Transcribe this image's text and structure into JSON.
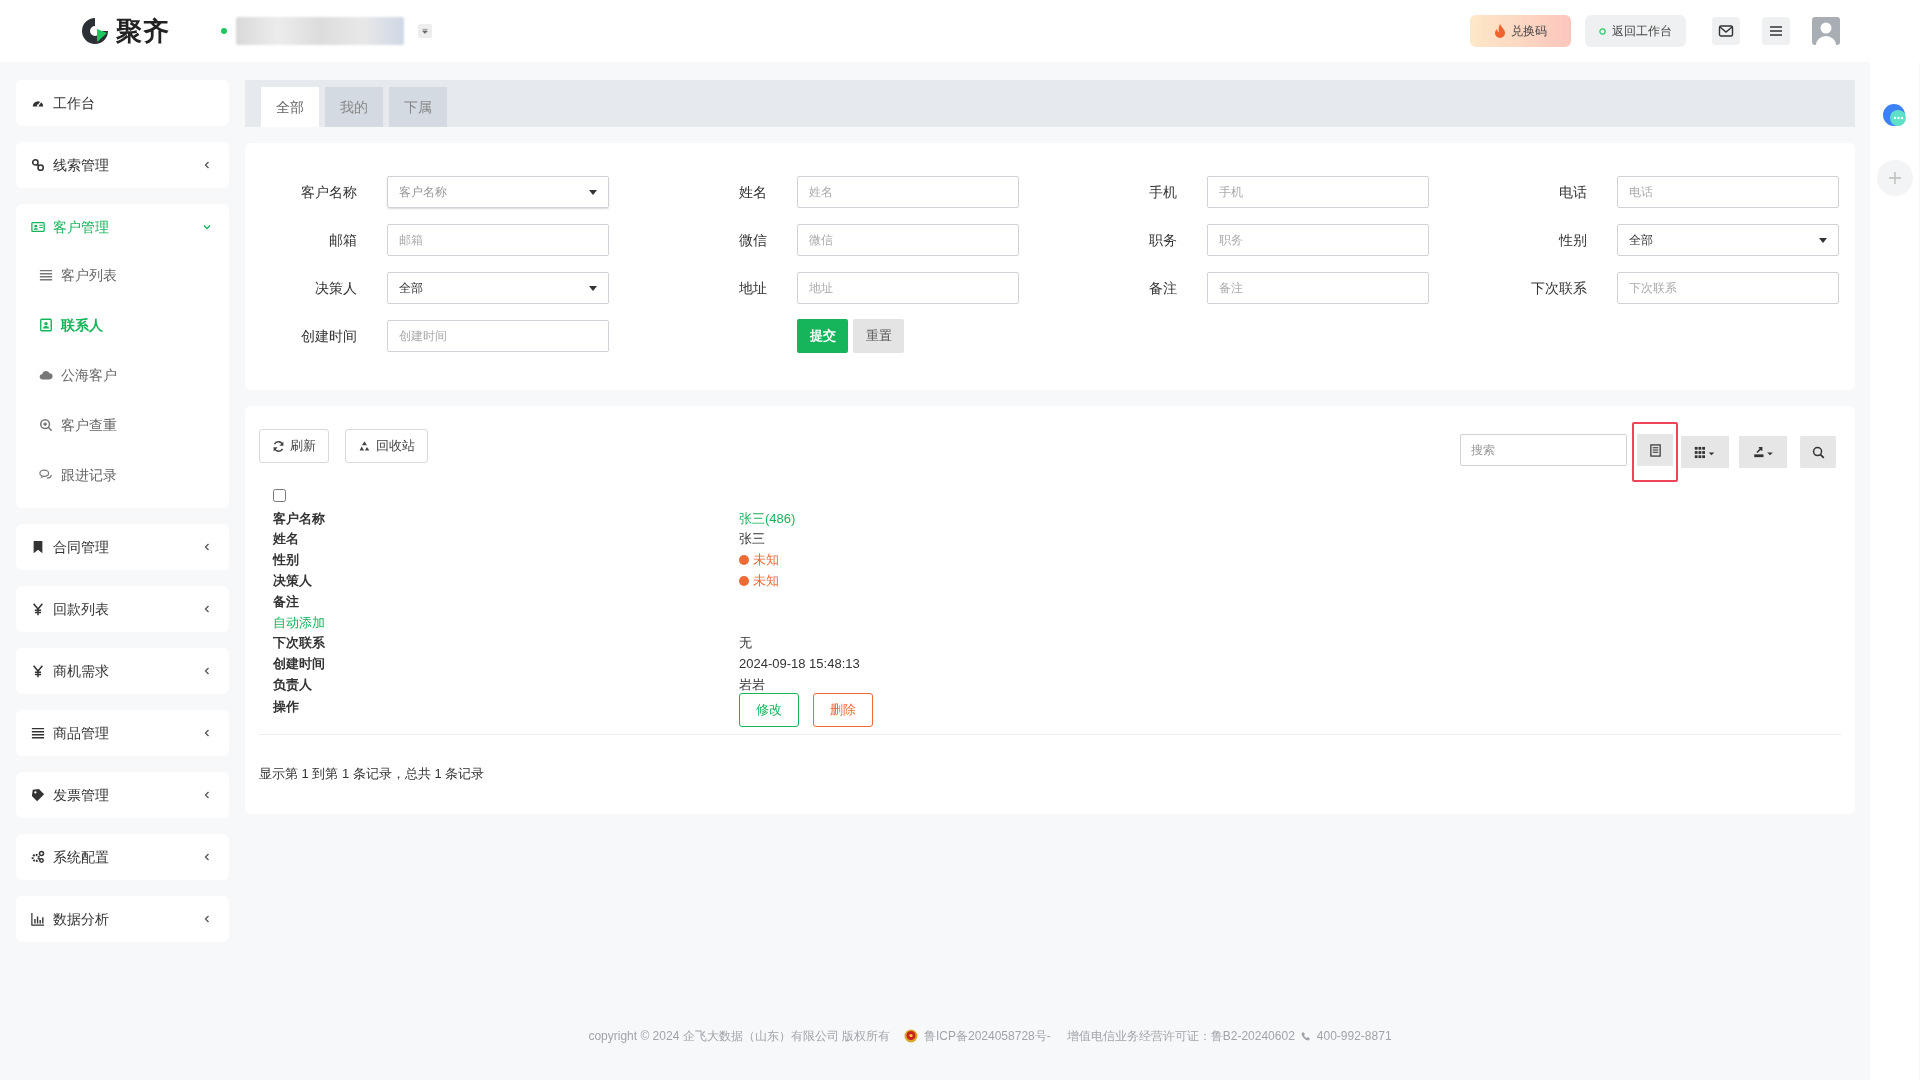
{
  "header": {
    "logo": "聚齐",
    "buttons": [
      {
        "label": "兑换码",
        "kind": "redeem"
      },
      {
        "label": "返回工作台",
        "kind": "back"
      }
    ]
  },
  "sidebar": [
    {
      "label": "工作台",
      "selected": false
    },
    {
      "label": "线索管理",
      "selected": false,
      "expanded": false
    },
    {
      "label": "客户管理",
      "selected": true,
      "expanded": true,
      "children": [
        {
          "label": "客户列表",
          "selected": false
        },
        {
          "label": "联系人",
          "selected": true
        },
        {
          "label": "公海客户",
          "selected": false
        },
        {
          "label": "客户查重",
          "selected": false
        },
        {
          "label": "跟进记录",
          "selected": false
        }
      ]
    },
    {
      "label": "合同管理",
      "selected": false,
      "expanded": false
    },
    {
      "label": "回款列表",
      "selected": false,
      "expanded": false
    },
    {
      "label": "商机需求",
      "selected": false,
      "expanded": false
    },
    {
      "label": "商品管理",
      "selected": false,
      "expanded": false
    },
    {
      "label": "发票管理",
      "selected": false,
      "expanded": false
    },
    {
      "label": "系统配置",
      "selected": false,
      "expanded": false
    },
    {
      "label": "数据分析",
      "selected": false,
      "expanded": false
    }
  ],
  "tabs": [
    {
      "label": "全部",
      "selected": true
    },
    {
      "label": "我的",
      "selected": false
    },
    {
      "label": "下属",
      "selected": false
    }
  ],
  "filters": [
    {
      "label": "客户名称",
      "kind": "select",
      "placeholder": "客户名称"
    },
    {
      "label": "姓名",
      "kind": "input",
      "placeholder": "姓名"
    },
    {
      "label": "手机",
      "kind": "input",
      "placeholder": "手机"
    },
    {
      "label": "电话",
      "kind": "input",
      "placeholder": "电话"
    },
    {
      "label": "邮箱",
      "kind": "input",
      "placeholder": "邮箱"
    },
    {
      "label": "微信",
      "kind": "input",
      "placeholder": "微信"
    },
    {
      "label": "职务",
      "kind": "input",
      "placeholder": "职务"
    },
    {
      "label": "性别",
      "kind": "select",
      "value": "全部"
    },
    {
      "label": "决策人",
      "kind": "select",
      "value": "全部"
    },
    {
      "label": "地址",
      "kind": "input",
      "placeholder": "地址"
    },
    {
      "label": "备注",
      "kind": "input",
      "placeholder": "备注"
    },
    {
      "label": "下次联系",
      "kind": "input",
      "placeholder": "下次联系"
    },
    {
      "label": "创建时间",
      "kind": "input",
      "placeholder": "创建时间"
    }
  ],
  "form_buttons": [
    {
      "label": "提交",
      "kind": "primary"
    },
    {
      "label": "重置",
      "kind": "default"
    }
  ],
  "toolbar": {
    "buttons": [
      {
        "label": "刷新",
        "kind": "refresh"
      },
      {
        "label": "回收站",
        "kind": "recycle"
      }
    ],
    "search": {
      "placeholder": "搜索"
    },
    "tools": [
      {
        "kind": "card",
        "highlighted": true
      },
      {
        "kind": "columns",
        "highlighted": false
      },
      {
        "kind": "export",
        "highlighted": false
      },
      {
        "kind": "search",
        "highlighted": false
      }
    ]
  },
  "record": {
    "checked": false,
    "rows": [
      {
        "kind": "link",
        "label": "客户名称",
        "value": "张三(486)"
      },
      {
        "kind": "text",
        "label": "姓名",
        "value": "张三"
      },
      {
        "kind": "status",
        "label": "性别",
        "value": "未知",
        "color": "#ee6b35"
      },
      {
        "kind": "status",
        "label": "决策人",
        "value": "未知",
        "color": "#ee6b35"
      },
      {
        "kind": "text",
        "label": "备注"
      },
      {
        "kind": "note",
        "text": "自动添加"
      },
      {
        "kind": "text",
        "label": "下次联系",
        "value": "无"
      },
      {
        "kind": "text",
        "label": "创建时间",
        "value": "2024-09-18 15:48:13"
      },
      {
        "kind": "text",
        "label": "负责人",
        "value": "岩岩"
      },
      {
        "kind": "actions",
        "label": "操作",
        "actions": [
          {
            "label": "修改",
            "kind": "edit"
          },
          {
            "label": "删除",
            "kind": "delete"
          }
        ]
      }
    ]
  },
  "pagination": "显示第 1 到第 1 条记录，总共 1 条记录",
  "footer": {
    "copyright": "copyright © 2024 企飞大数据（山东）有限公司 版权所有",
    "icp": "鲁ICP备2024058728号-",
    "license": "增值电信业务经营许可证：鲁B2-20240602",
    "phone": "400-992-8871"
  }
}
